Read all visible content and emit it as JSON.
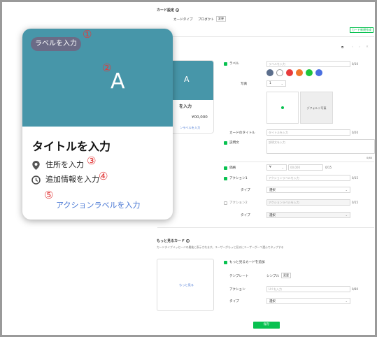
{
  "header": {
    "title": "カード設定",
    "tabs": [
      "カードタイプ",
      "プロダクト"
    ],
    "change_label": "変更"
  },
  "top_right_button": "カード新規作成",
  "pagination_glyphs": [
    "‹",
    "›",
    "✕"
  ],
  "preview_card": {
    "image_letter": "A",
    "title_fragment": "を入力",
    "price": "¥00,000",
    "action_fragment": "ンラベルを入力"
  },
  "form": {
    "label": {
      "name": "ラベル",
      "placeholder": "ラベルを入力",
      "count": "0/10"
    },
    "colors": [
      "#5b6e8c",
      "#ffffff",
      "#e83b3b",
      "#f0762a",
      "#1ec63b",
      "#4a6fe0"
    ],
    "photo": {
      "name": "写真",
      "value": "1",
      "default_label": "デフォルト写真"
    },
    "card_title": {
      "name": "カードのタイトル",
      "placeholder": "タイトルを入力",
      "count": "0/20"
    },
    "description": {
      "name": "説明文",
      "placeholder": "説明文を入力",
      "count": "0/60"
    },
    "price": {
      "name": "価格",
      "currency": "¥",
      "placeholder": "00,000",
      "count": "0/15"
    },
    "action1": {
      "name": "アクション1",
      "placeholder": "アクションラベルを入力",
      "count": "0/15",
      "type_label": "タイプ",
      "type_value": "選択"
    },
    "action2": {
      "name": "アクション2",
      "placeholder": "アクションラベルを入力",
      "count": "0/15",
      "type_label": "タイプ",
      "type_value": "選択"
    }
  },
  "more_card": {
    "title": "もっと見るカード",
    "description": "カードタイプメッセージの最後に表示されます。ユーザーがもっと見るにユーザーが一つ選んでタップする",
    "preview_label": "もっと見る",
    "add_label": "もっと見るカードを追加",
    "template_label": "テンプレート",
    "template_value": "シンプル",
    "template_change": "変更",
    "action_label": "アクション",
    "action_placeholder": "Url を入力",
    "action_count": "0/80",
    "type_label": "タイプ",
    "type_value": "選択"
  },
  "save_button": "保存",
  "big_card": {
    "label_pill": "ラベルを入力",
    "image_letter": "A",
    "title": "タイトルを入力",
    "address": "住所を入力",
    "extra_info": "追加情報を入力",
    "action_label": "アクションラベルを入力"
  },
  "markers": [
    "①",
    "②",
    "③",
    "④",
    "⑤"
  ],
  "colors": {
    "accent_green": "#08c150",
    "card_image": "#4796a9",
    "marker_red": "#e23b3b",
    "action_blue": "#4a78d4"
  }
}
